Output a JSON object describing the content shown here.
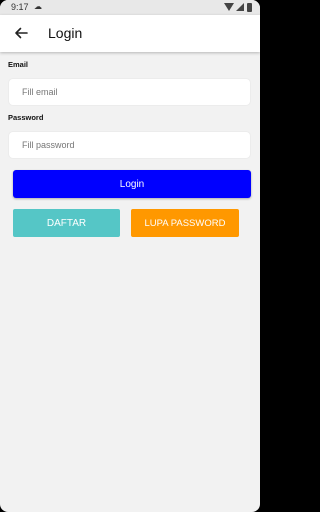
{
  "status_bar": {
    "time": "9:17",
    "cloud_icon": "☁"
  },
  "app_bar": {
    "title": "Login",
    "back_icon": "arrow-left-icon"
  },
  "form": {
    "email_label": "Email",
    "email_placeholder": "Fill email",
    "email_value": "",
    "password_label": "Password",
    "password_placeholder": "Fill password",
    "password_value": ""
  },
  "buttons": {
    "login_label": "Login",
    "daftar_label": "DAFTAR",
    "lupa_label": "LUPA PASSWORD"
  },
  "colors": {
    "login": "#0000ff",
    "daftar": "#55c6c6",
    "lupa": "#ff9800",
    "background": "#f2f2f2"
  }
}
